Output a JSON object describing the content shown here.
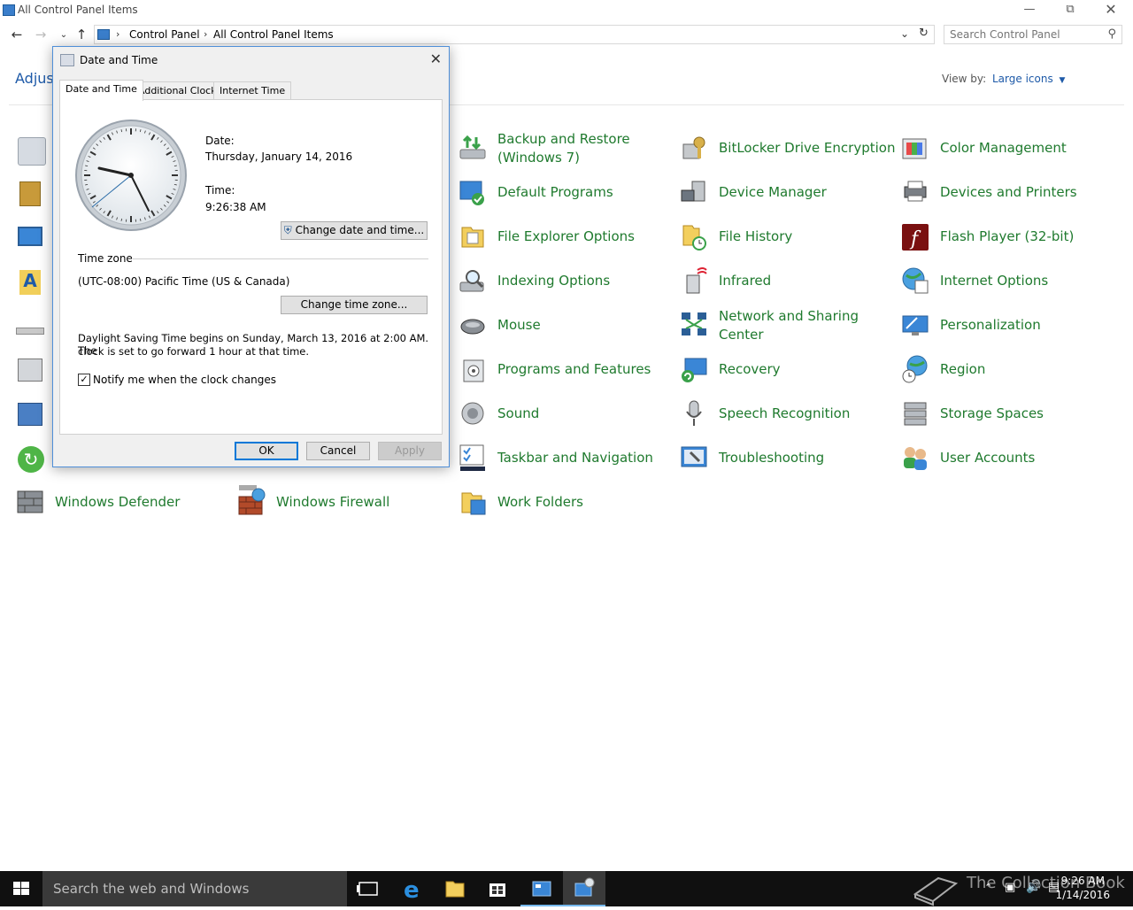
{
  "window": {
    "title": "All Control Panel Items",
    "minimize_icon": "minimize-icon",
    "restore_icon": "restore-icon",
    "close_icon": "close-icon"
  },
  "address": {
    "breadcrumb": [
      "Control Panel",
      "All Control Panel Items"
    ],
    "search_placeholder": "Search Control Panel"
  },
  "header": {
    "heading": "Adjust",
    "view_by_label": "View by:",
    "view_by_value": "Large icons"
  },
  "items": [
    {
      "label": "Backup and Restore (Windows 7)",
      "icon": "backup-icon"
    },
    {
      "label": "BitLocker Drive Encryption",
      "icon": "bitlocker-icon"
    },
    {
      "label": "Color Management",
      "icon": "color-icon"
    },
    {
      "label": "Default Programs",
      "icon": "default-programs-icon"
    },
    {
      "label": "Device Manager",
      "icon": "device-manager-icon"
    },
    {
      "label": "Devices and Printers",
      "icon": "printer-icon"
    },
    {
      "label": "File Explorer Options",
      "icon": "folder-options-icon"
    },
    {
      "label": "File History",
      "icon": "file-history-icon"
    },
    {
      "label": "Flash Player (32-bit)",
      "icon": "flash-icon"
    },
    {
      "label": "Indexing Options",
      "icon": "indexing-icon"
    },
    {
      "label": "Infrared",
      "icon": "infrared-icon"
    },
    {
      "label": "Internet Options",
      "icon": "internet-options-icon"
    },
    {
      "label": "Mouse",
      "icon": "mouse-icon"
    },
    {
      "label": "Network and Sharing Center",
      "icon": "network-icon"
    },
    {
      "label": "Personalization",
      "icon": "personalization-icon"
    },
    {
      "label": "Programs and Features",
      "icon": "programs-icon"
    },
    {
      "label": "Recovery",
      "icon": "recovery-icon"
    },
    {
      "label": "Region",
      "icon": "region-icon"
    },
    {
      "label": "Sound",
      "icon": "sound-icon"
    },
    {
      "label": "Speech Recognition",
      "icon": "microphone-icon"
    },
    {
      "label": "Storage Spaces",
      "icon": "storage-icon"
    },
    {
      "label": "Taskbar and Navigation",
      "icon": "taskbar-icon"
    },
    {
      "label": "Troubleshooting",
      "icon": "troubleshoot-icon"
    },
    {
      "label": "User Accounts",
      "icon": "users-icon"
    },
    {
      "label": "Windows Defender",
      "icon": "defender-icon"
    },
    {
      "label": "Windows Firewall",
      "icon": "firewall-icon"
    },
    {
      "label": "Work Folders",
      "icon": "work-folders-icon"
    }
  ],
  "dialog": {
    "title": "Date and Time",
    "tabs": [
      "Date and Time",
      "Additional Clocks",
      "Internet Time"
    ],
    "date_label": "Date:",
    "date_value": "Thursday, January 14, 2016",
    "time_label": "Time:",
    "time_value": "9:26:38 AM",
    "change_datetime_button": "Change date and time...",
    "timezone_heading": "Time zone",
    "timezone_value": "(UTC-08:00) Pacific Time (US & Canada)",
    "change_timezone_button": "Change time zone...",
    "dst_text_line1": "Daylight Saving Time begins on Sunday, March 13, 2016 at 2:00 AM. The",
    "dst_text_line2": "clock is set to go forward 1 hour at that time.",
    "notify_label": "Notify me when the clock changes",
    "notify_checked": true,
    "ok": "OK",
    "cancel": "Cancel",
    "apply": "Apply"
  },
  "taskbar": {
    "search_placeholder": "Search the web and Windows",
    "time": "9:26 AM",
    "date": "1/14/2016",
    "watermark": "The Collection Book"
  },
  "colors": {
    "link_green": "#1f7a2e",
    "accent_blue": "#0078d7",
    "taskbar": "#101010"
  }
}
